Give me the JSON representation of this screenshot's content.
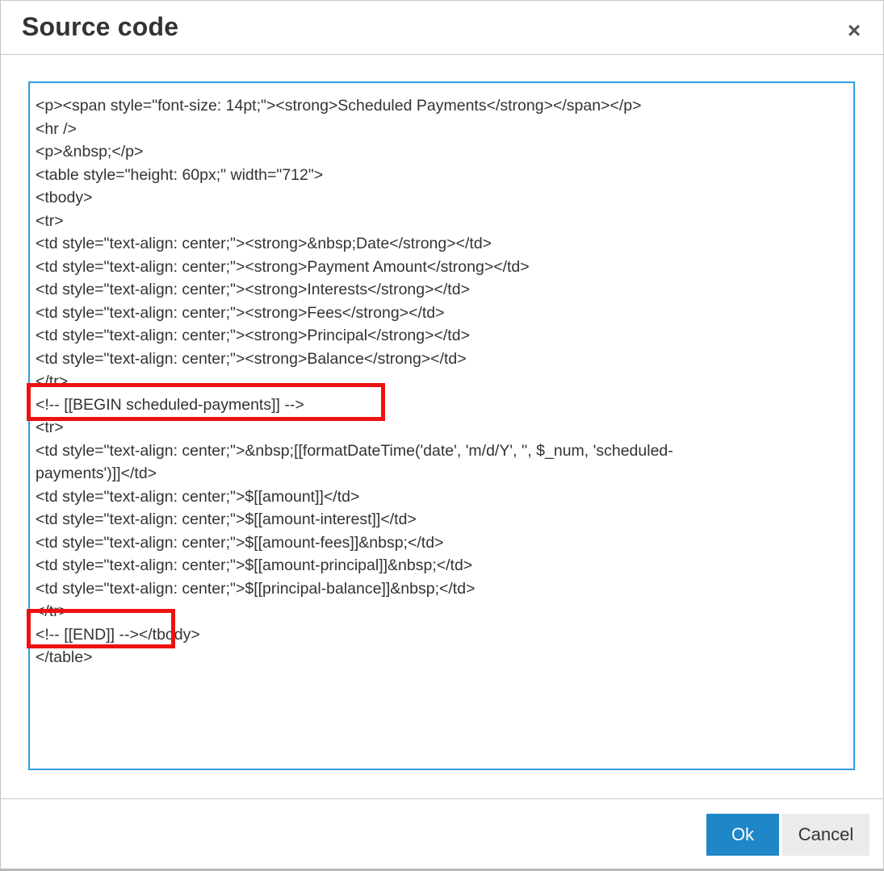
{
  "dialog": {
    "title": "Source code",
    "close_label": "×"
  },
  "editor": {
    "lines": [
      "<p><span style=\"font-size: 14pt;\"><strong>Scheduled Payments</strong></span></p>",
      "<hr />",
      "<p>&nbsp;</p>",
      "<table style=\"height: 60px;\" width=\"712\">",
      "<tbody>",
      "<tr>",
      "<td style=\"text-align: center;\"><strong>&nbsp;Date</strong></td>",
      "<td style=\"text-align: center;\"><strong>Payment Amount</strong></td>",
      "<td style=\"text-align: center;\"><strong>Interests</strong></td>",
      "<td style=\"text-align: center;\"><strong>Fees</strong></td>",
      "<td style=\"text-align: center;\"><strong>Principal</strong></td>",
      "<td style=\"text-align: center;\"><strong>Balance</strong></td>",
      "</tr>",
      "<!-- [[BEGIN scheduled-payments]] -->",
      "<tr>",
      "<td style=\"text-align: center;\">&nbsp;[[formatDateTime('date', 'm/d/Y', '', $_num, 'scheduled-",
      "payments')]]</td>",
      "<td style=\"text-align: center;\">$[[amount]]</td>",
      "<td style=\"text-align: center;\">$[[amount-interest]]</td>",
      "<td style=\"text-align: center;\">$[[amount-fees]]&nbsp;</td>",
      "<td style=\"text-align: center;\">$[[amount-principal]]&nbsp;</td>",
      "<td style=\"text-align: center;\">$[[principal-balance]]&nbsp;</td>",
      "</tr>",
      "<!-- [[END]] --></tbody>",
      "</table>"
    ]
  },
  "footer": {
    "ok_label": "Ok",
    "cancel_label": "Cancel"
  },
  "colors": {
    "accent": "#1f86c8",
    "focus_border": "#2f9ee0",
    "highlight": "#ee1111"
  }
}
